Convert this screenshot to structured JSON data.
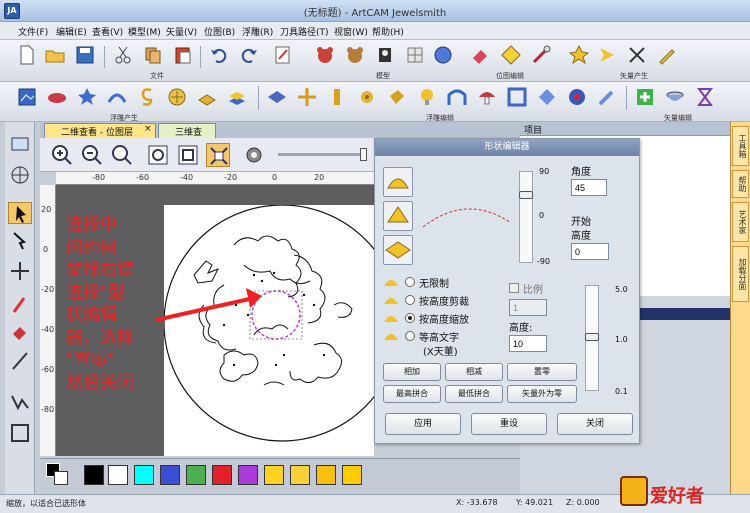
{
  "window": {
    "title": "(无标题) - ArtCAM Jewelsmith",
    "logo": "JA"
  },
  "menu": [
    "文件(F)",
    "编辑(E)",
    "查看(V)",
    "模型(M)",
    "矢量(V)",
    "位图(B)",
    "浮雕(R)",
    "刀具路径(T)",
    "视窗(W)",
    "帮助(H)"
  ],
  "toolbar": {
    "groups": [
      "文件",
      "模型",
      "位图编辑",
      "矢量产生",
      "浮雕产生",
      "浮雕编辑",
      "矢量编辑"
    ]
  },
  "tabs": [
    {
      "label": "二维查看 - 位图层",
      "active": true,
      "close": "×"
    },
    {
      "label": "三维查看",
      "active": false
    }
  ],
  "ruler": {
    "labels": [
      "-80",
      "-60",
      "-40",
      "-20",
      "0",
      "20"
    ],
    "vlabels": [
      "20",
      "0",
      "-20",
      "-40",
      "-60",
      "-80",
      "-100"
    ]
  },
  "annotation": {
    "lines": [
      "选择中",
      "间的圆",
      "鼠标右键",
      "选择\"型",
      "状编辑",
      "器，选择",
      "\"置零\"",
      "然后关闭"
    ]
  },
  "project_pane": {
    "title": "项目"
  },
  "dock_tabs": [
    "工具箱",
    "帮助",
    "艺术家",
    "加载分面"
  ],
  "dialog": {
    "title": "形状编辑器",
    "angle_label": "角度",
    "angle_value": "45",
    "start_height_label": "开始",
    "start_height_label2": "高度",
    "start_height_value": "0",
    "slider_scale": [
      "90",
      "0",
      "-90"
    ],
    "ratio_label": "比例",
    "ratio_value": "1",
    "height_label": "高度:",
    "height_value": "10",
    "height_scale": [
      "5.0",
      "1.0",
      "0.1"
    ],
    "options": [
      "无限制",
      "按高度剪裁",
      "按高度缩放",
      "等高文字",
      "(X天董)"
    ],
    "selected_option": 2,
    "buttons": {
      "add": "相加",
      "sub": "相减",
      "zero": "置零",
      "max": "最高拼合",
      "min": "最低拼合",
      "vec_zero": "矢量外为零",
      "apply": "应用",
      "reset": "重设",
      "close": "关闭"
    }
  },
  "palette": {
    "colors": [
      "#000000",
      "#ffffff",
      "#00ffff",
      "#3a4fd6",
      "#4caf50",
      "#e0202a",
      "#ab3bd8",
      "#ffd21f",
      "#f3d23a",
      "#f7c00f",
      "#ffcc00"
    ]
  },
  "status": {
    "message": "缩放，以适合已选形体",
    "x": "X: -33.678",
    "y": "Y: 49.021",
    "z": "Z: 0.000"
  },
  "watermark": {
    "text": "爱好者"
  }
}
